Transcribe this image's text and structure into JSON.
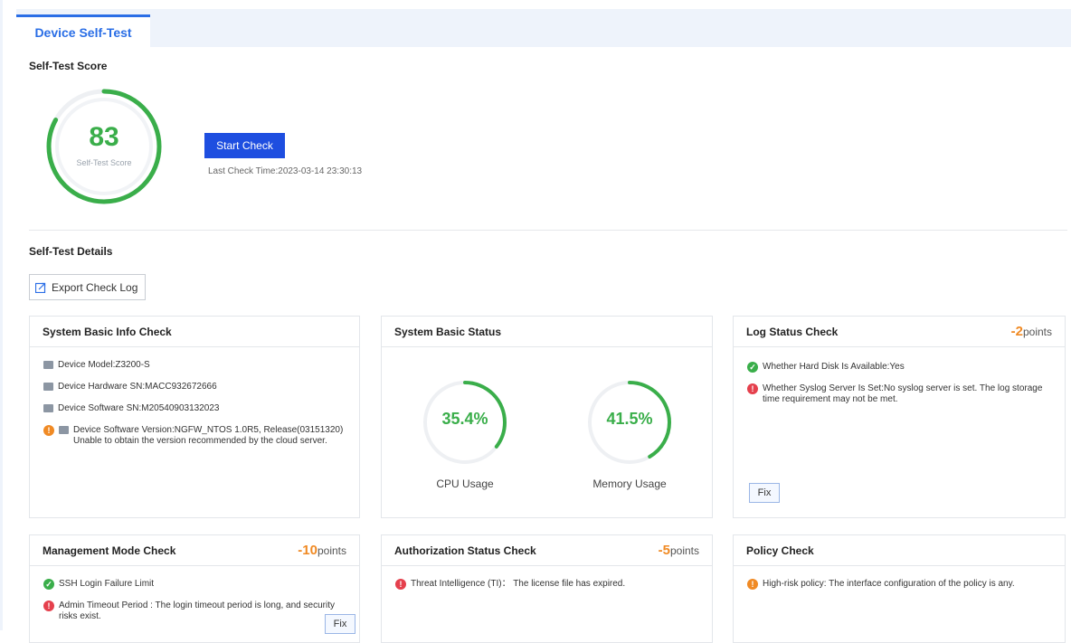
{
  "tab": {
    "label": "Device Self-Test"
  },
  "score": {
    "section_title": "Self-Test Score",
    "value": "83",
    "value_fraction": 0.83,
    "label": "Self-Test Score",
    "start_button": "Start Check",
    "last_check": "Last Check Time:2023-03-14 23:30:13"
  },
  "details": {
    "section_title": "Self-Test Details",
    "export_button": "Export Check Log"
  },
  "cards": {
    "basic_info": {
      "title": "System Basic Info Check",
      "model": "Device Model:Z3200-S",
      "hw_sn": "Device Hardware SN:MACC932672666",
      "sw_sn": "Device Software SN:M20540903132023",
      "sw_version": "Device Software Version:NGFW_NTOS 1.0R5, Release(03151320) Unable to obtain the version recommended by the cloud server."
    },
    "basic_status": {
      "title": "System Basic Status",
      "cpu_value": "35.4%",
      "cpu_fraction": 0.354,
      "cpu_label": "CPU Usage",
      "mem_value": "41.5%",
      "mem_fraction": 0.415,
      "mem_label": "Memory Usage"
    },
    "log_status": {
      "title": "Log Status Check",
      "points": "-2",
      "points_suffix": "points",
      "item1": "Whether Hard Disk Is Available:Yes",
      "item2": "Whether Syslog Server Is Set:No syslog server is set. The log storage time requirement may not be met.",
      "fix": "Fix"
    },
    "mgmt_mode": {
      "title": "Management Mode Check",
      "points": "-10",
      "points_suffix": "points",
      "item1": "SSH Login Failure Limit",
      "item2": "Admin Timeout Period : The login timeout period is long, and security risks exist.",
      "fix": "Fix"
    },
    "auth_status": {
      "title": "Authorization Status Check",
      "points": "-5",
      "points_suffix": "points",
      "item1": "Threat Intelligence (TI)： The license file has expired."
    },
    "policy": {
      "title": "Policy Check",
      "item1": "High-risk policy: The interface configuration of the policy is any."
    }
  },
  "colors": {
    "accent": "#2a6ee6",
    "button": "#1e4ee0",
    "ok": "#3aae4a",
    "error": "#e5404d",
    "warning": "#f08a24"
  }
}
